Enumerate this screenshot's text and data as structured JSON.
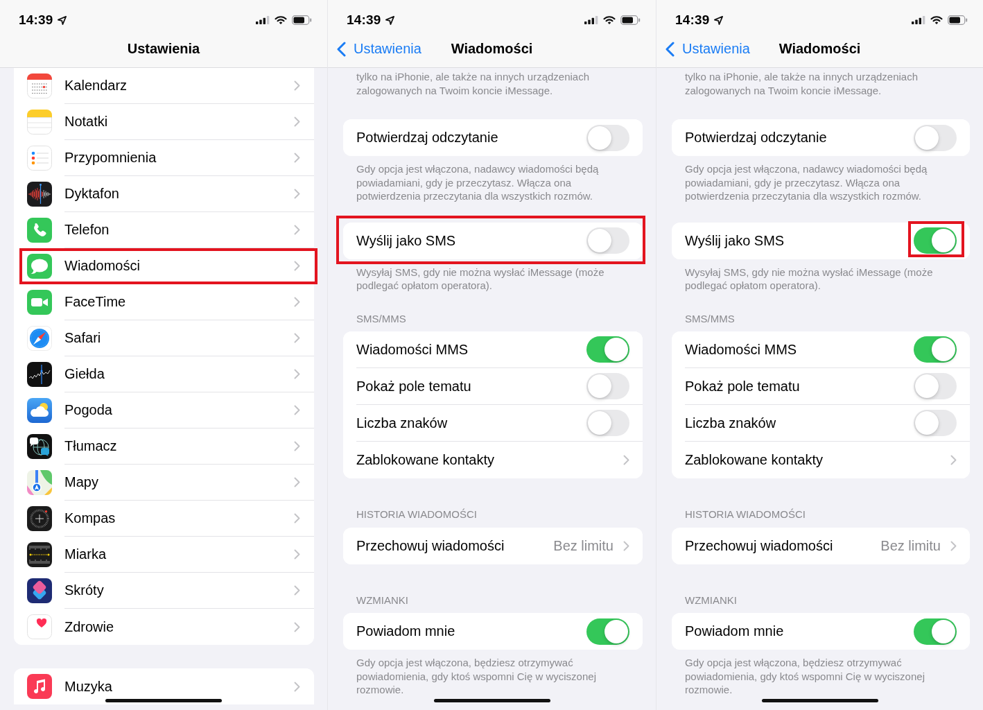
{
  "screens": [
    {
      "kind": "settings_list",
      "status_bar": {
        "time": "14:39"
      },
      "nav": {
        "title": "Ustawienia"
      },
      "groups": [
        {
          "items": [
            {
              "label": "Kalendarz",
              "highlighted": false
            },
            {
              "label": "Notatki",
              "highlighted": false
            },
            {
              "label": "Przypomnienia",
              "highlighted": false
            },
            {
              "label": "Dyktafon",
              "highlighted": false
            },
            {
              "label": "Telefon",
              "highlighted": false
            },
            {
              "label": "Wiadomości",
              "highlighted": true
            },
            {
              "label": "FaceTime",
              "highlighted": false
            },
            {
              "label": "Safari",
              "highlighted": false
            },
            {
              "label": "Giełda",
              "highlighted": false
            },
            {
              "label": "Pogoda",
              "highlighted": false
            },
            {
              "label": "Tłumacz",
              "highlighted": false
            },
            {
              "label": "Mapy",
              "highlighted": false
            },
            {
              "label": "Kompas",
              "highlighted": false
            },
            {
              "label": "Miarka",
              "highlighted": false
            },
            {
              "label": "Skróty",
              "highlighted": false
            },
            {
              "label": "Zdrowie",
              "highlighted": false
            }
          ]
        },
        {
          "items": [
            {
              "label": "Muzyka",
              "highlighted": false
            }
          ]
        }
      ]
    },
    {
      "kind": "app_settings",
      "status_bar": {
        "time": "14:39"
      },
      "nav": {
        "back": "Ustawienia",
        "title": "Wiadomości"
      },
      "intro": "tylko na iPhonie, ale także na innych urządzeniach zalogowanych na Twoim koncie iMessage.",
      "sections": [
        {
          "rows": [
            {
              "kind": "switch",
              "label": "Potwierdzaj odczytanie",
              "highlighted": false,
              "switch": {
                "on": false,
                "highlighted": false
              }
            }
          ],
          "footer": "Gdy opcja jest włączona, nadawcy wiadomości będą powiadamiani, gdy je przeczytasz. Włącza ona potwierdzenia przeczytania dla wszystkich rozmów."
        },
        {
          "rows": [
            {
              "kind": "switch",
              "label": "Wyślij jako SMS",
              "highlighted": true,
              "switch": {
                "on": false,
                "highlighted": false
              }
            }
          ],
          "footer": "Wysyłaj SMS, gdy nie można wysłać iMessage (może podlegać opłatom operatora)."
        },
        {
          "header": "SMS/MMS",
          "rows": [
            {
              "kind": "switch",
              "label": "Wiadomości MMS",
              "highlighted": false,
              "switch": {
                "on": true,
                "highlighted": false
              }
            },
            {
              "kind": "switch",
              "label": "Pokaż pole tematu",
              "highlighted": false,
              "switch": {
                "on": false,
                "highlighted": false
              }
            },
            {
              "kind": "switch",
              "label": "Liczba znaków",
              "highlighted": false,
              "switch": {
                "on": false,
                "highlighted": false
              }
            },
            {
              "kind": "link",
              "label": "Zablokowane kontakty",
              "highlighted": false
            }
          ]
        },
        {
          "header": "HISTORIA WIADOMOŚCI",
          "rows": [
            {
              "kind": "value",
              "label": "Przechowuj wiadomości",
              "value": "Bez limitu",
              "highlighted": false
            }
          ]
        },
        {
          "header": "WZMIANKI",
          "rows": [
            {
              "kind": "switch",
              "label": "Powiadom mnie",
              "highlighted": false,
              "switch": {
                "on": true,
                "highlighted": false
              }
            }
          ],
          "footer": "Gdy opcja jest włączona, będziesz otrzymywać powiadomienia, gdy ktoś wspomni Cię w wyciszonej rozmowie."
        }
      ]
    },
    {
      "kind": "app_settings",
      "status_bar": {
        "time": "14:39"
      },
      "nav": {
        "back": "Ustawienia",
        "title": "Wiadomości"
      },
      "intro": "tylko na iPhonie, ale także na innych urządzeniach zalogowanych na Twoim koncie iMessage.",
      "sections": [
        {
          "rows": [
            {
              "kind": "switch",
              "label": "Potwierdzaj odczytanie",
              "highlighted": false,
              "switch": {
                "on": false,
                "highlighted": false
              }
            }
          ],
          "footer": "Gdy opcja jest włączona, nadawcy wiadomości będą powiadamiani, gdy je przeczytasz. Włącza ona potwierdzenia przeczytania dla wszystkich rozmów."
        },
        {
          "rows": [
            {
              "kind": "switch",
              "label": "Wyślij jako SMS",
              "highlighted": false,
              "switch": {
                "on": true,
                "highlighted": true
              }
            }
          ],
          "footer": "Wysyłaj SMS, gdy nie można wysłać iMessage (może podlegać opłatom operatora)."
        },
        {
          "header": "SMS/MMS",
          "rows": [
            {
              "kind": "switch",
              "label": "Wiadomości MMS",
              "highlighted": false,
              "switch": {
                "on": true,
                "highlighted": false
              }
            },
            {
              "kind": "switch",
              "label": "Pokaż pole tematu",
              "highlighted": false,
              "switch": {
                "on": false,
                "highlighted": false
              }
            },
            {
              "kind": "switch",
              "label": "Liczba znaków",
              "highlighted": false,
              "switch": {
                "on": false,
                "highlighted": false
              }
            },
            {
              "kind": "link",
              "label": "Zablokowane kontakty",
              "highlighted": false
            }
          ]
        },
        {
          "header": "HISTORIA WIADOMOŚCI",
          "rows": [
            {
              "kind": "value",
              "label": "Przechowuj wiadomości",
              "value": "Bez limitu",
              "highlighted": false
            }
          ]
        },
        {
          "header": "WZMIANKI",
          "rows": [
            {
              "kind": "switch",
              "label": "Powiadom mnie",
              "highlighted": false,
              "switch": {
                "on": true,
                "highlighted": false
              }
            }
          ],
          "footer": "Gdy opcja jest włączona, będziesz otrzymywać powiadomienia, gdy ktoś wspomni Cię w wyciszonej rozmowie."
        }
      ]
    }
  ]
}
